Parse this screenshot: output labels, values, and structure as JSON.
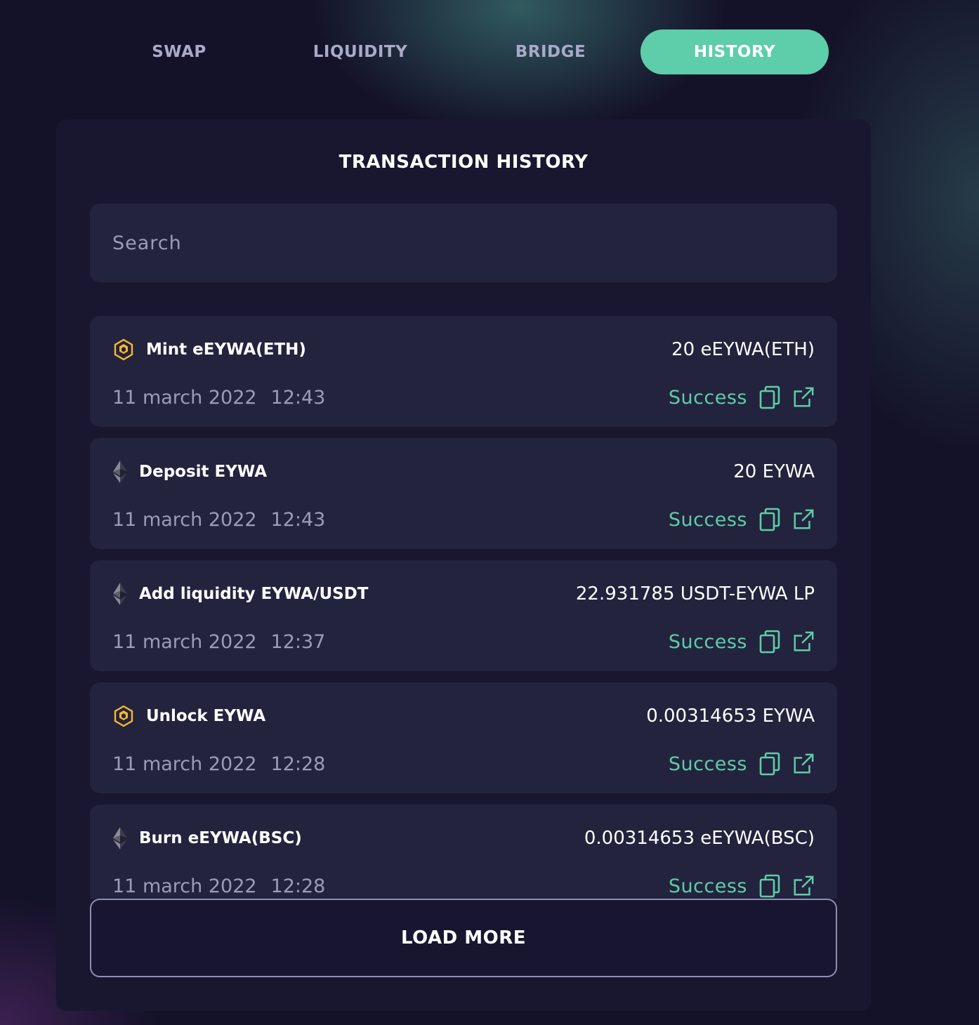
{
  "tabs": [
    {
      "label": "SWAP",
      "active": false
    },
    {
      "label": "LIQUIDITY",
      "active": false
    },
    {
      "label": "BRIDGE",
      "active": false
    },
    {
      "label": "HISTORY",
      "active": true
    }
  ],
  "title": "TRANSACTION HISTORY",
  "search": {
    "placeholder": "Search",
    "value": ""
  },
  "transactions": [
    {
      "chain": "bsc-icon",
      "name": "Mint eEYWA(ETH)",
      "amount": "20 eEYWA(ETH)",
      "date": "11 march 2022",
      "time": "12:43",
      "status": "Success"
    },
    {
      "chain": "ethereum-icon",
      "name": "Deposit EYWA",
      "amount": "20 EYWA",
      "date": "11 march 2022",
      "time": "12:43",
      "status": "Success"
    },
    {
      "chain": "ethereum-icon",
      "name": "Add liquidity EYWA/USDT",
      "amount": "22.931785 USDT-EYWA LP",
      "date": "11 march 2022",
      "time": "12:37",
      "status": "Success"
    },
    {
      "chain": "bsc-icon",
      "name": "Unlock EYWA",
      "amount": "0.00314653 EYWA",
      "date": "11 march 2022",
      "time": "12:28",
      "status": "Success"
    },
    {
      "chain": "ethereum-icon",
      "name": "Burn eEYWA(BSC)",
      "amount": "0.00314653 eEYWA(BSC)",
      "date": "11 march 2022",
      "time": "12:28",
      "status": "Success"
    }
  ],
  "load_more_label": "LOAD MORE",
  "colors": {
    "accent": "#5ecda9",
    "background": "#141229",
    "card": "#19172f",
    "row": "#23233e",
    "muted_text": "#9b9cb8",
    "bsc_gold": "#f3ba2f"
  }
}
